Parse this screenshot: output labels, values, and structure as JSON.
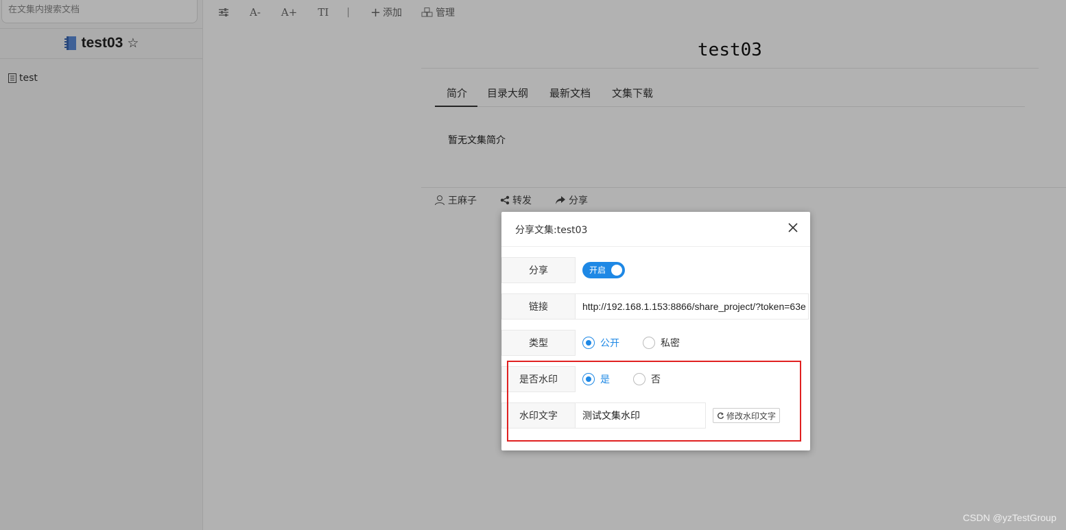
{
  "sidebar": {
    "search_placeholder": "在文集内搜索文档",
    "project_name": "test03",
    "docs": [
      {
        "label": "test"
      }
    ]
  },
  "toolbar": {
    "font_decrease": "A-",
    "font_increase": "A+",
    "text_style": "TI",
    "separator": "|",
    "add_label": "添加",
    "manage_label": "管理"
  },
  "main": {
    "title": "test03",
    "tabs": [
      {
        "label": "简介",
        "active": true
      },
      {
        "label": "目录大纲",
        "active": false
      },
      {
        "label": "最新文档",
        "active": false
      },
      {
        "label": "文集下载",
        "active": false
      }
    ],
    "intro_text": "暂无文集简介",
    "footer": {
      "author": "王麻子",
      "forward_label": "转发",
      "share_label": "分享"
    }
  },
  "modal": {
    "title": "分享文集:test03",
    "share": {
      "label": "分享",
      "toggle_text": "开启",
      "enabled": true
    },
    "link": {
      "label": "链接",
      "value": "http://192.168.1.153:8866/share_project/?token=63e"
    },
    "type": {
      "label": "类型",
      "options": [
        {
          "label": "公开",
          "selected": true
        },
        {
          "label": "私密",
          "selected": false
        }
      ]
    },
    "watermark": {
      "label": "是否水印",
      "options": [
        {
          "label": "是",
          "selected": true
        },
        {
          "label": "否",
          "selected": false
        }
      ]
    },
    "watermark_text": {
      "label": "水印文字",
      "value": "测试文集水印",
      "button_label": "修改水印文字"
    }
  },
  "colors": {
    "accent": "#1e88e5",
    "highlight_box": "#e02020",
    "overlay": "rgba(0,0,0,0.3)"
  },
  "page_watermark": "CSDN @yzTestGroup"
}
